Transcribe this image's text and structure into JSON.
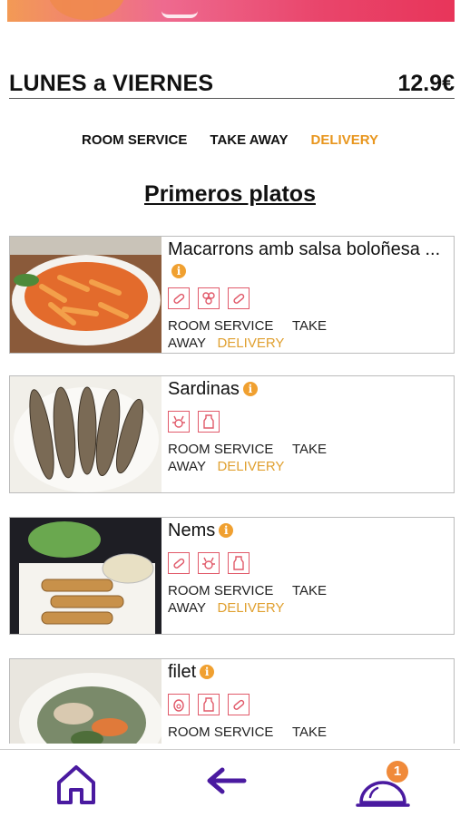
{
  "menu": {
    "name": "LUNES a VIERNES",
    "price": "12.9€"
  },
  "filters": [
    {
      "label": "ROOM SERVICE",
      "active": false
    },
    {
      "label": "TAKE AWAY",
      "active": false
    },
    {
      "label": "DELIVERY",
      "active": true
    }
  ],
  "section_title": "Primeros platos",
  "dishes": [
    {
      "title": "Macarrons amb salsa boloñesa ...",
      "allergens": [
        "gluten-icon",
        "mollusc-icon",
        "gluten-icon"
      ],
      "svc_line1": "ROOM SERVICE     TAKE",
      "svc_line2_a": "AWAY",
      "svc_line2_b": "DELIVERY"
    },
    {
      "title": "Sardinas",
      "allergens": [
        "crustacean-icon",
        "milk-icon"
      ],
      "svc_line1": "ROOM SERVICE     TAKE",
      "svc_line2_a": "AWAY",
      "svc_line2_b": "DELIVERY"
    },
    {
      "title": "Nems",
      "allergens": [
        "gluten-icon",
        "crustacean-icon",
        "milk-icon"
      ],
      "svc_line1": "ROOM SERVICE     TAKE",
      "svc_line2_a": "AWAY",
      "svc_line2_b": "DELIVERY"
    },
    {
      "title": "filet",
      "allergens": [
        "egg-icon",
        "milk-icon",
        "gluten-icon"
      ],
      "svc_line1": "ROOM SERVICE     TAKE",
      "svc_line2_a": "",
      "svc_line2_b": ""
    }
  ],
  "nav": {
    "home_icon": "home-icon",
    "back_icon": "back-arrow-icon",
    "cart_icon": "cloche-icon",
    "cart_badge": "1"
  },
  "colors": {
    "accent": "#e8961e",
    "nav": "#4a1aa0",
    "allergen": "#e15a6a"
  }
}
